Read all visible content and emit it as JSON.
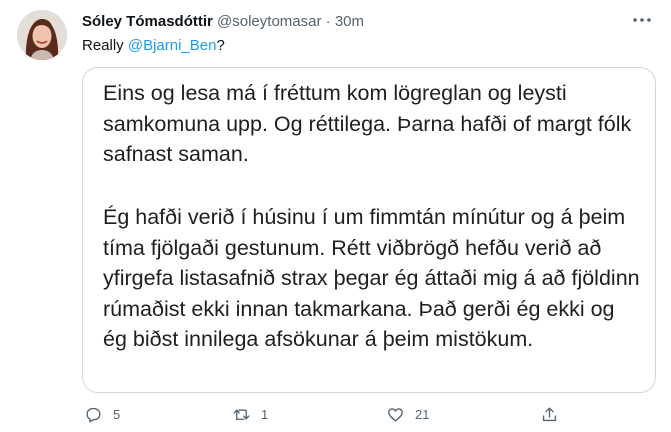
{
  "tweet": {
    "author_name": "Sóley Tómasdóttir",
    "handle": "@soleytomasar",
    "separator": "·",
    "time": "30m",
    "text_prefix": "Really ",
    "mention": "@Bjarni_Ben",
    "text_suffix": "?"
  },
  "image": {
    "paragraph1": "Eins og lesa má í fréttum kom lögreglan og leysti samkomuna upp. Og réttilega. Þarna hafði of margt fólk safnast saman.",
    "paragraph2": "Ég hafði verið í húsinu í um fimmtán mínútur og á þeim tíma fjölgaði gestunum. Rétt viðbrögð hefðu verið að yfirgefa listasafnið strax þegar ég áttaði mig á að fjöldinn rúmaðist ekki innan takmarkana. Það gerði ég ekki og ég biðst innilega afsökunar á þeim mistökum."
  },
  "actions": {
    "reply_count": "5",
    "retweet_count": "1",
    "like_count": "21",
    "reply_icon": "reply-icon",
    "retweet_icon": "retweet-icon",
    "like_icon": "heart-icon",
    "share_icon": "share-icon"
  },
  "colors": {
    "link": "#1d9bf0",
    "secondary_text": "#536471",
    "border": "#cfd9de"
  }
}
